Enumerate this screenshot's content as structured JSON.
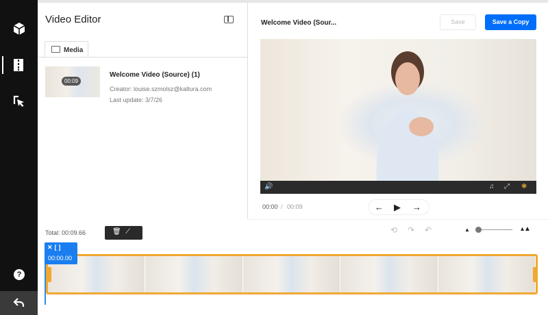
{
  "sidebar": {
    "items": [
      {
        "icon": "cube-icon"
      },
      {
        "icon": "film-icon"
      },
      {
        "icon": "pointer-icon"
      },
      {
        "icon": "help-icon"
      },
      {
        "icon": "back-icon"
      }
    ]
  },
  "left_panel": {
    "title": "Video Editor",
    "tab": "Media",
    "media": {
      "duration": "00:09",
      "title": "Welcome Video (Source) (1)",
      "creator": "Creator: louise.szmolsz@kaltura.com",
      "updated": "Last update: 3/7/26"
    }
  },
  "player": {
    "title": "Welcome Video (Sour...",
    "save_label": "Save",
    "save_copy_label": "Save a Copy",
    "current_time": "00:00",
    "separator": "/",
    "total_time": "00:09"
  },
  "timeline": {
    "total": "Total: 00:09.66",
    "playhead_time": "00:00.00",
    "zoom_level": 0.05,
    "frames": 5
  },
  "colors": {
    "accent": "#006efa",
    "clip_border": "#f0a830",
    "sidebar": "#111111"
  }
}
